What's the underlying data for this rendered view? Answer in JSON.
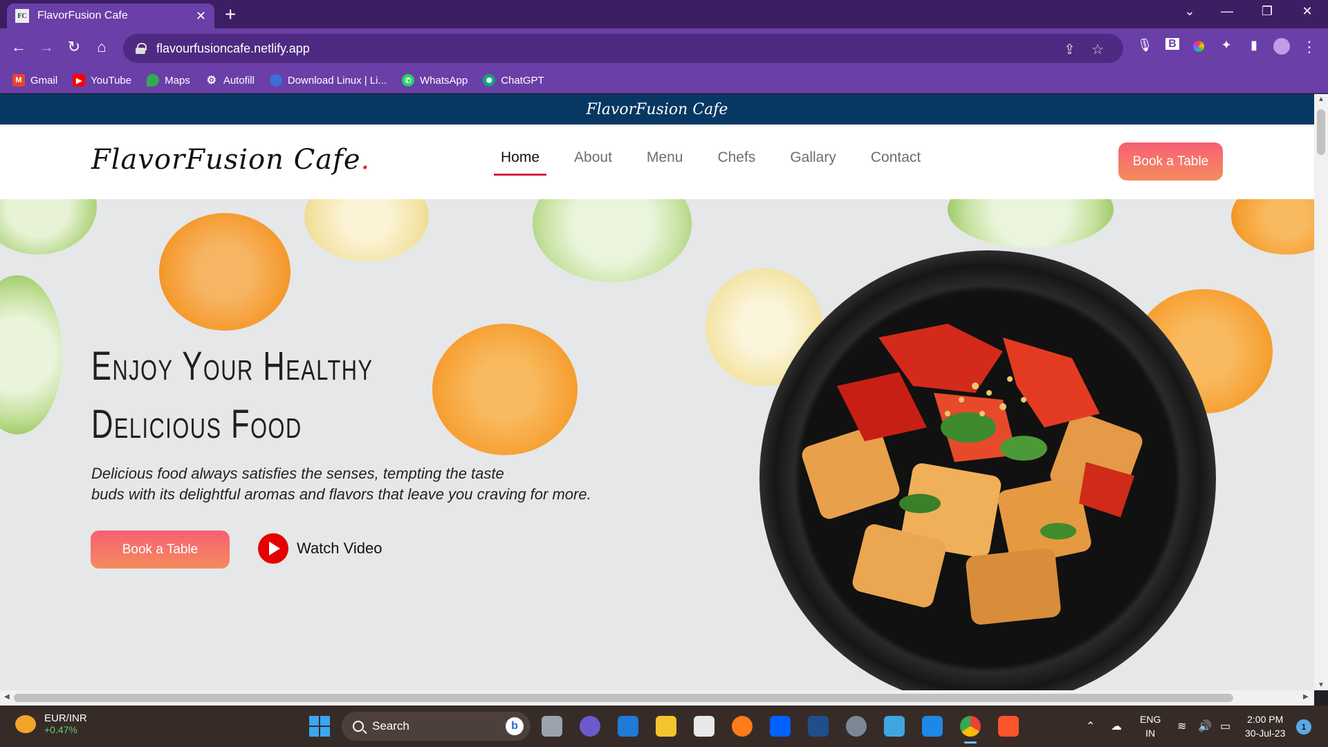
{
  "browser": {
    "tab_title": "FlavorFusion Cafe",
    "tab_favicon": "FC",
    "url": "flavourfusioncafe.netlify.app",
    "bookmarks": [
      {
        "label": "Gmail",
        "icon": "gmail-icon",
        "color": "#ea4335"
      },
      {
        "label": "YouTube",
        "icon": "youtube-icon",
        "color": "#ff0000"
      },
      {
        "label": "Maps",
        "icon": "maps-icon",
        "color": "#34a853"
      },
      {
        "label": "Autofill",
        "icon": "gear-icon",
        "color": "#5f6368"
      },
      {
        "label": "Download Linux | Li...",
        "icon": "linux-icon",
        "color": "#3b6fd6"
      },
      {
        "label": "WhatsApp",
        "icon": "whatsapp-icon",
        "color": "#25d366"
      },
      {
        "label": "ChatGPT",
        "icon": "chatgpt-icon",
        "color": "#10a37f"
      }
    ]
  },
  "site": {
    "top_strip_title": "FlavorFusion Cafe",
    "logo": "FlavorFusion Cafe",
    "logo_dot": ".",
    "nav": [
      "Home",
      "About",
      "Menu",
      "Chefs",
      "Gallary",
      "Contact"
    ],
    "active_nav": "Home",
    "header_cta": "Book a Table",
    "accent_color": "#f65f75",
    "topbar_color": "#073763"
  },
  "hero": {
    "title_line1": "Enjoy Your Healthy",
    "title_line2": "Delicious Food",
    "text_line1": "Delicious food always satisfies the senses, tempting the taste",
    "text_line2": "buds with its delightful aromas and flavors that leave you craving for more.",
    "cta": "Book a Table",
    "video_label": "Watch Video"
  },
  "taskbar": {
    "ticker_name": "EUR/INR",
    "ticker_change": "+0.47%",
    "search_placeholder": "Search",
    "lang_top": "ENG",
    "lang_bottom": "IN",
    "time": "2:00 PM",
    "date": "30-Jul-23",
    "notification_count": "1"
  }
}
